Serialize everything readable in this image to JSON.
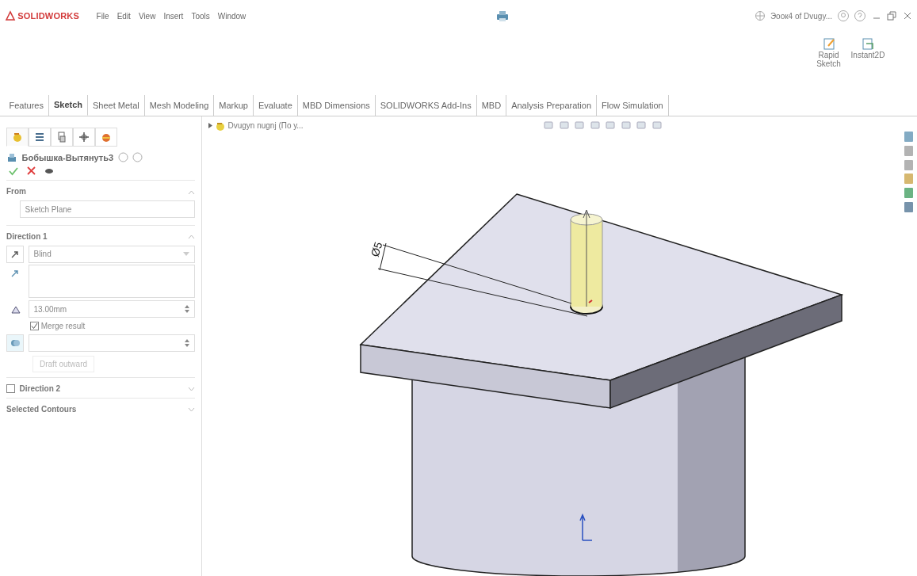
{
  "app": {
    "logo": "SOLIDWORKS",
    "menu": [
      "File",
      "Edit",
      "View",
      "Insert",
      "Tools",
      "Window"
    ],
    "document_title": "Эоок4 of Dvugy..."
  },
  "ribbon": {
    "buttons": [
      {
        "label": "Rapid Sketch",
        "kind": "rapid"
      },
      {
        "label": "Instant2D",
        "kind": "instant"
      }
    ]
  },
  "tabs": [
    {
      "label": "Features",
      "selected": false
    },
    {
      "label": "Sketch",
      "selected": true
    },
    {
      "label": "Sheet Metal",
      "selected": false
    },
    {
      "label": "Mesh Modeling",
      "selected": false
    },
    {
      "label": "Markup",
      "selected": false
    },
    {
      "label": "Evaluate",
      "selected": false
    },
    {
      "label": "MBD Dimensions",
      "selected": false
    },
    {
      "label": "SOLIDWORKS Add-Ins",
      "selected": false
    },
    {
      "label": "MBD",
      "selected": false
    },
    {
      "label": "Analysis Preparation",
      "selected": false
    },
    {
      "label": "Flow Simulation",
      "selected": false
    }
  ],
  "panel_tabs": [
    {
      "kind": "feature",
      "selected": true
    },
    {
      "kind": "property",
      "selected": false
    },
    {
      "kind": "config",
      "selected": false
    },
    {
      "kind": "dimxpert",
      "selected": false
    },
    {
      "kind": "display",
      "selected": false
    }
  ],
  "property_manager": {
    "title": "Бобышка-Вытянуть3",
    "sections": [
      {
        "kind": "from",
        "title": "From",
        "expanded": true,
        "start": "Sketch Plane"
      },
      {
        "kind": "direction",
        "title": "Direction 1",
        "expanded": true,
        "end_condition": "Blind",
        "depth": "13.00mm",
        "merge_label": "Merge result",
        "merge_checked": true,
        "draft_label": "Draft outward",
        "draft_disabled": true
      },
      {
        "kind": "checkable",
        "title": "Direction 2",
        "expanded": false,
        "checked": false
      },
      {
        "kind": "plain",
        "title": "Selected Contours",
        "expanded": false
      }
    ]
  },
  "tree": {
    "root": "Dvugyn nugnj (По у..."
  },
  "viewport": {
    "dimension": "Ø5"
  }
}
